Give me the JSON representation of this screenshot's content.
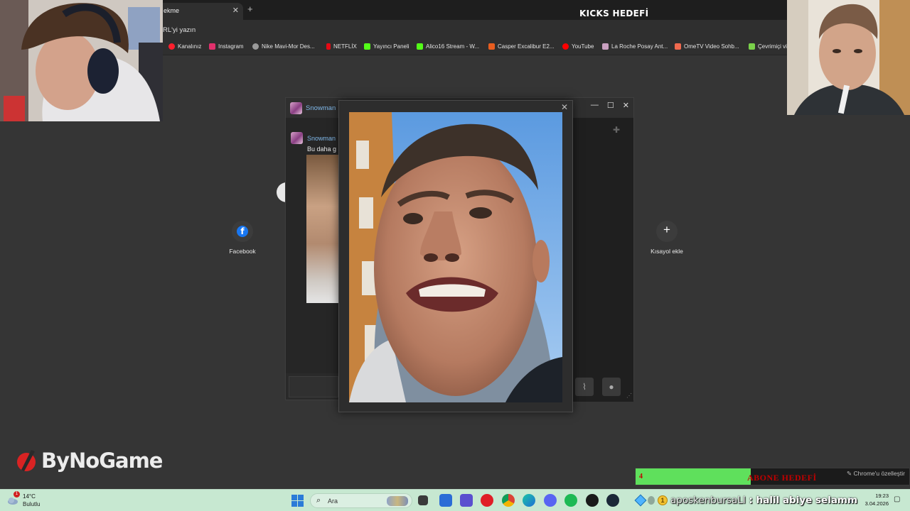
{
  "browser": {
    "tab_title": "ekme",
    "address_placeholder": "RL'yi yazın",
    "bookmarks": [
      {
        "label": "Kanalınız",
        "color": "#ff1f2d"
      },
      {
        "label": "Instagram",
        "color": "#e1306c"
      },
      {
        "label": "Nike Mavi-Mor Des...",
        "color": "#9a9a9a"
      },
      {
        "label": "NETFLİX",
        "color": "#e50914"
      },
      {
        "label": "Yayıncı Paneli",
        "color": "#53fc18"
      },
      {
        "label": "Alico16 Stream - W...",
        "color": "#53fc18"
      },
      {
        "label": "Casper Excalibur E2...",
        "color": "#e85d1f"
      },
      {
        "label": "YouTube",
        "color": "#ff0000"
      },
      {
        "label": "La Roche Posay Ant...",
        "color": "#c9a0c0"
      },
      {
        "label": "OmeTV Video Sohb...",
        "color": "#f06a4f"
      },
      {
        "label": "Çevrimiçi vi",
        "color": "#7ad14a"
      }
    ]
  },
  "overlay": {
    "kicks_goal_title": "KICKS HEDEFİ",
    "subscriber_goal": {
      "count": "4",
      "label": "ABONE HEDEFİ",
      "fill_percent": 42
    },
    "brand_logo": "ByNoGame"
  },
  "new_tab": {
    "shortcuts": [
      {
        "label": "Facebook",
        "icon": "facebook-icon"
      },
      {
        "label": "Kısayol ekle",
        "icon": "plus-icon"
      }
    ],
    "customize_label": "Chrome'u özelleştir"
  },
  "chat_window": {
    "title": "Snowman",
    "message_author": "Snowman",
    "message_text": "Bu daha g"
  },
  "taskbar": {
    "weather_temp": "14°C",
    "weather_desc": "Bulutlu",
    "weather_badge": "1",
    "search_placeholder": "Ara",
    "time": "19:23",
    "date": "3.04.2026"
  },
  "chat_ticker": {
    "username": "aposkenbursaLI",
    "separator": " : ",
    "message": "halil abiye selamm",
    "coin_label": "1"
  },
  "colors": {
    "kick_green": "#53fc18",
    "taskbar_bg": "#c7e8d1",
    "goal_text": "#c00000"
  }
}
